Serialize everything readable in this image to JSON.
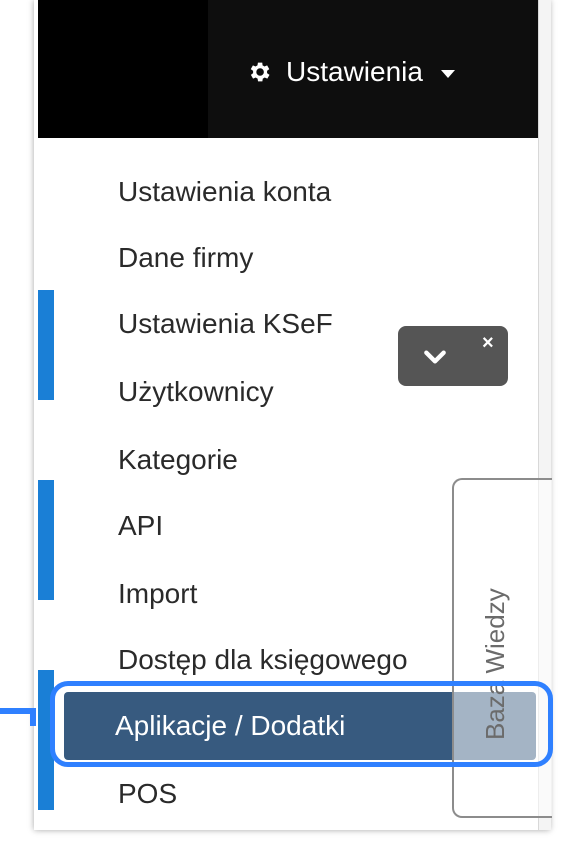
{
  "navbar": {
    "settings_label": "Ustawienia"
  },
  "menu": {
    "items": [
      {
        "label": "Ustawienia konta"
      },
      {
        "label": "Dane firmy"
      },
      {
        "label": "Ustawienia KSeF"
      },
      {
        "label": "Użytkownicy"
      },
      {
        "label": "Kategorie"
      },
      {
        "label": "API"
      },
      {
        "label": "Import"
      },
      {
        "label": "Dostęp dla księgowego"
      },
      {
        "label": "Aplikacje / Dodatki"
      },
      {
        "label": "POS"
      }
    ],
    "active_index": 8
  },
  "knowledge_tab": {
    "label": "Baza Wiedzy"
  },
  "chat_widget": {
    "close_glyph": "×"
  },
  "colors": {
    "navbar_bg": "#0e0e0e",
    "active_bg": "#375a7f",
    "highlight_ring": "#2f80ff",
    "side_tab_blue": "#1a7fd6"
  },
  "icons": {
    "settings": "gear-icon",
    "caret": "caret-down-icon",
    "chat_toggle": "chevron-down-icon",
    "chat_close": "close-icon"
  }
}
